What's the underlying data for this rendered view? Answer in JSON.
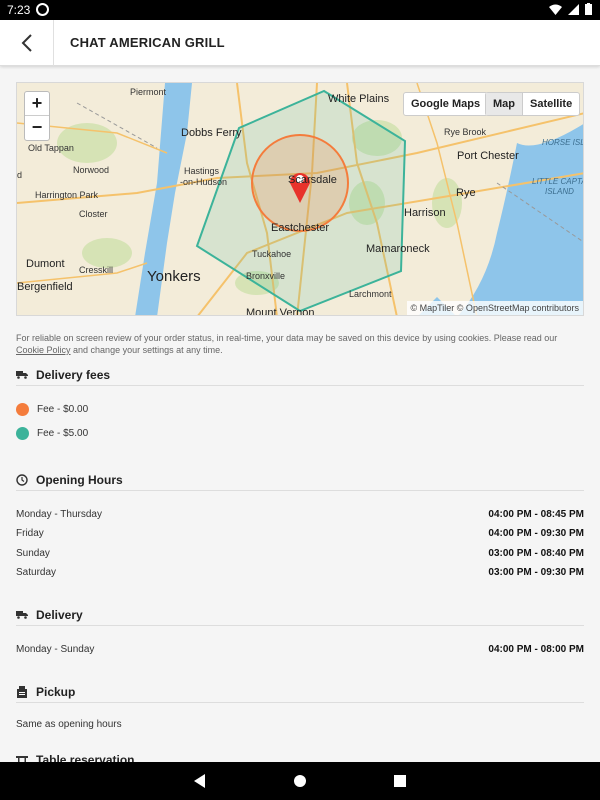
{
  "status_bar": {
    "time": "7:23"
  },
  "header": {
    "title": "CHAT AMERICAN GRILL"
  },
  "map": {
    "google_maps_label": "Google Maps",
    "map_type_options": [
      "Map",
      "Satellite"
    ],
    "active_map_type": "Map",
    "zoom_in": "+",
    "zoom_out": "−",
    "attribution": "© MapTiler © OpenStreetMap contributors",
    "labels": {
      "piermont": "Piermont",
      "white_plains": "White Plains",
      "dobbs_ferry": "Dobbs Ferry",
      "rye_brook": "Rye Brook",
      "old_tappan": "Old Tappan",
      "port_chester": "Port Chester",
      "horse_island": "HORSE ISLAND",
      "norwood": "Norwood",
      "hastings": "Hastings",
      "on_hudson": "-on-Hudson",
      "scarsdale": "Scarsdale",
      "little_captain": "LITTLE CAPTAIN",
      "island": "ISLAND",
      "harrington_park": "Harrington Park",
      "rye": "Rye",
      "closter": "Closter",
      "harrison": "Harrison",
      "eastchester": "Eastchester",
      "mamaroneck": "Mamaroneck",
      "tuckahoe": "Tuckahoe",
      "dumont": "Dumont",
      "cresskill": "Cresskill",
      "yonkers": "Yonkers",
      "bronxville": "Bronxville",
      "bergenfield": "Bergenfield",
      "larchmont": "Larchmont",
      "mount_vernon": "Mount Vernon",
      "d": "d"
    }
  },
  "notice": {
    "text_before": "For reliable on screen review of your order status, in real-time, your data may be saved on this device by using cookies. Please read our",
    "link": "Cookie Policy",
    "text_after": " and change your settings at any time."
  },
  "delivery_fees": {
    "heading": "Delivery fees",
    "items": [
      {
        "label": "Fee - $0.00",
        "color": "#f47c3c"
      },
      {
        "label": "Fee - $5.00",
        "color": "#3cb39a"
      }
    ]
  },
  "opening_hours": {
    "heading": "Opening Hours",
    "rows": [
      {
        "day": "Monday - Thursday",
        "hours": "04:00 PM - 08:45 PM"
      },
      {
        "day": "Friday",
        "hours": "04:00 PM - 09:30 PM"
      },
      {
        "day": "Sunday",
        "hours": "03:00 PM - 08:40 PM"
      },
      {
        "day": "Saturday",
        "hours": "03:00 PM - 09:30 PM"
      }
    ]
  },
  "delivery": {
    "heading": "Delivery",
    "rows": [
      {
        "day": "Monday - Sunday",
        "hours": "04:00 PM - 08:00 PM"
      }
    ]
  },
  "pickup": {
    "heading": "Pickup",
    "text": "Same as opening hours"
  },
  "table_reservation": {
    "heading": "Table reservation"
  },
  "colors": {
    "accent_marker": "#e8322b",
    "zone_inner": "#f47c3c",
    "zone_outer": "#3cb39a"
  }
}
